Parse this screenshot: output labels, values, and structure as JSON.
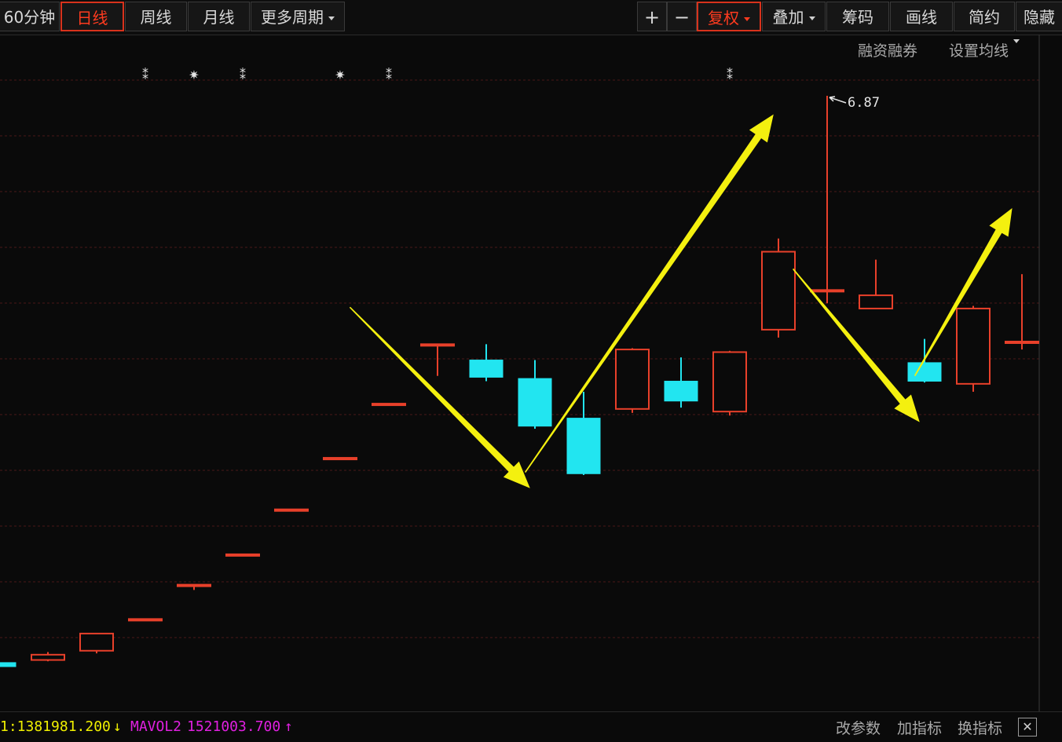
{
  "toolbar": {
    "left": [
      {
        "label": "60分钟",
        "active": false
      },
      {
        "label": "日线",
        "active": true
      },
      {
        "label": "周线",
        "active": false
      },
      {
        "label": "月线",
        "active": false
      },
      {
        "label": "更多周期",
        "active": false,
        "dropdown": true
      }
    ],
    "right": [
      {
        "label": "+",
        "name": "zoom-in-button"
      },
      {
        "label": "−",
        "name": "zoom-out-button"
      },
      {
        "label": "复权",
        "name": "fuquan-button",
        "active": true,
        "dropdown": true
      },
      {
        "label": "叠加",
        "name": "overlay-button",
        "dropdown": true
      },
      {
        "label": "筹码",
        "name": "chip-button"
      },
      {
        "label": "画线",
        "name": "draw-line-button"
      },
      {
        "label": "简约",
        "name": "simple-button"
      },
      {
        "label": "隐藏",
        "name": "hide-button"
      }
    ]
  },
  "subbar": {
    "margin": "融资融券",
    "ma_settings": "设置均线"
  },
  "chart": {
    "type": "candlestick",
    "high_label": "6.87",
    "colors": {
      "up": "#e8402a",
      "down": "#22e5f0",
      "arrow": "#f4f00f",
      "grid": "#4a1818",
      "marker": "#e6e6e6"
    },
    "candles": [
      {
        "o": 2.58,
        "h": 2.58,
        "l": 2.52,
        "c": 2.55
      },
      {
        "o": 2.6,
        "h": 2.66,
        "l": 2.59,
        "c": 2.64
      },
      {
        "o": 2.67,
        "h": 2.8,
        "l": 2.65,
        "c": 2.8
      },
      {
        "o": 2.91,
        "h": 2.91,
        "l": 2.91,
        "c": 2.91
      },
      {
        "o": 3.17,
        "h": 3.17,
        "l": 3.13,
        "c": 3.17
      },
      {
        "o": 3.4,
        "h": 3.4,
        "l": 3.4,
        "c": 3.4
      },
      {
        "o": 3.74,
        "h": 3.74,
        "l": 3.74,
        "c": 3.74
      },
      {
        "o": 4.13,
        "h": 4.13,
        "l": 4.13,
        "c": 4.13
      },
      {
        "o": 4.54,
        "h": 4.54,
        "l": 4.54,
        "c": 4.54
      },
      {
        "o": 4.99,
        "h": 4.99,
        "l": 4.75,
        "c": 4.99
      },
      {
        "o": 4.87,
        "h": 4.99,
        "l": 4.71,
        "c": 4.74
      },
      {
        "o": 4.73,
        "h": 4.87,
        "l": 4.35,
        "c": 4.37
      },
      {
        "o": 4.43,
        "h": 4.63,
        "l": 4.0,
        "c": 4.01
      },
      {
        "o": 4.5,
        "h": 4.96,
        "l": 4.47,
        "c": 4.95
      },
      {
        "o": 4.71,
        "h": 4.89,
        "l": 4.51,
        "c": 4.56
      },
      {
        "o": 4.48,
        "h": 4.94,
        "l": 4.45,
        "c": 4.93
      },
      {
        "o": 5.1,
        "h": 5.79,
        "l": 5.04,
        "c": 5.69
      },
      {
        "o": 5.4,
        "h": 6.87,
        "l": 5.3,
        "c": 5.4
      },
      {
        "o": 5.26,
        "h": 5.63,
        "l": 5.26,
        "c": 5.36
      },
      {
        "o": 4.85,
        "h": 5.03,
        "l": 4.7,
        "c": 4.71
      },
      {
        "o": 4.69,
        "h": 5.28,
        "l": 4.63,
        "c": 5.26
      },
      {
        "o": 5.0,
        "h": 5.52,
        "l": 4.95,
        "c": 5.01
      }
    ],
    "markers": [
      {
        "i": 3,
        "glyph": "⁑"
      },
      {
        "i": 4,
        "glyph": "✷"
      },
      {
        "i": 5,
        "glyph": "⁑"
      },
      {
        "i": 7,
        "glyph": "✷"
      },
      {
        "i": 8,
        "glyph": "⁑"
      },
      {
        "i": 15,
        "glyph": "⁑"
      }
    ],
    "arrows": [
      {
        "from": {
          "i": 7.2,
          "v": 5.27
        },
        "to": {
          "i": 10.9,
          "v": 3.9
        }
      },
      {
        "from": {
          "i": 10.8,
          "v": 4.02
        },
        "to": {
          "i": 15.9,
          "v": 6.73
        }
      },
      {
        "from": {
          "i": 16.3,
          "v": 5.56
        },
        "to": {
          "i": 18.9,
          "v": 4.4
        }
      },
      {
        "from": {
          "i": 18.8,
          "v": 4.75
        },
        "to": {
          "i": 20.8,
          "v": 6.02
        }
      }
    ]
  },
  "indicator": {
    "left_text": "1:1381981.200",
    "left_arrow": "↓",
    "name": "MAVOL2",
    "value": "1521003.700",
    "right_arrow": "↑"
  },
  "bottom": {
    "params": "改参数",
    "add": "加指标",
    "switch": "换指标",
    "close": "✕"
  }
}
